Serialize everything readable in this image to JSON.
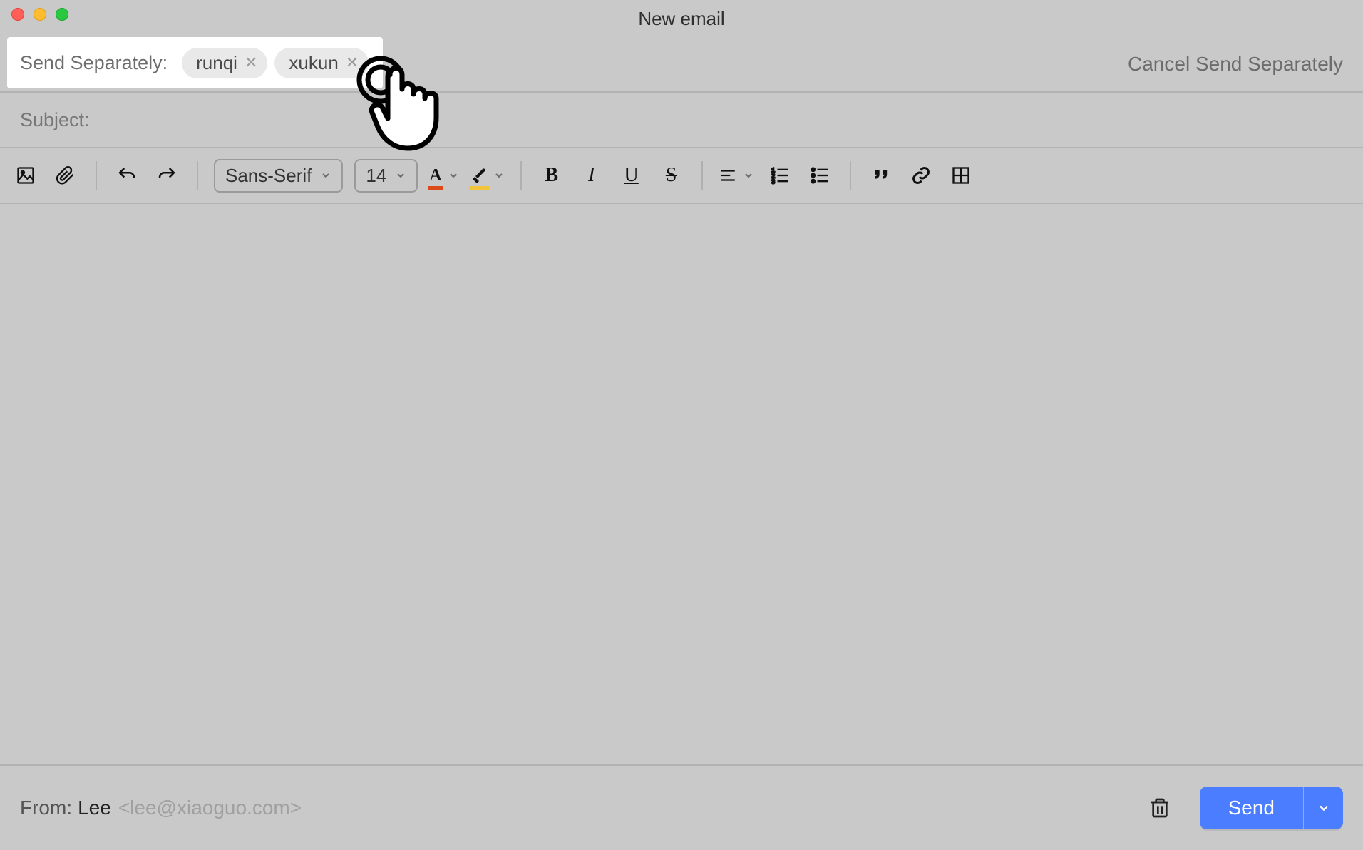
{
  "window": {
    "title": "New email"
  },
  "send_separately": {
    "label": "Send Separately:",
    "recipients": [
      {
        "name": "runqi"
      },
      {
        "name": "xukun"
      }
    ],
    "cancel_label": "Cancel Send Separately"
  },
  "subject": {
    "label": "Subject:"
  },
  "toolbar": {
    "font_family": "Sans-Serif",
    "font_size": "14",
    "text_color": "#dd4a1a",
    "highlight_color": "#f2c53c"
  },
  "from": {
    "label": "From:",
    "name": "Lee",
    "email": "<lee@xiaoguo.com>"
  },
  "send": {
    "label": "Send"
  }
}
